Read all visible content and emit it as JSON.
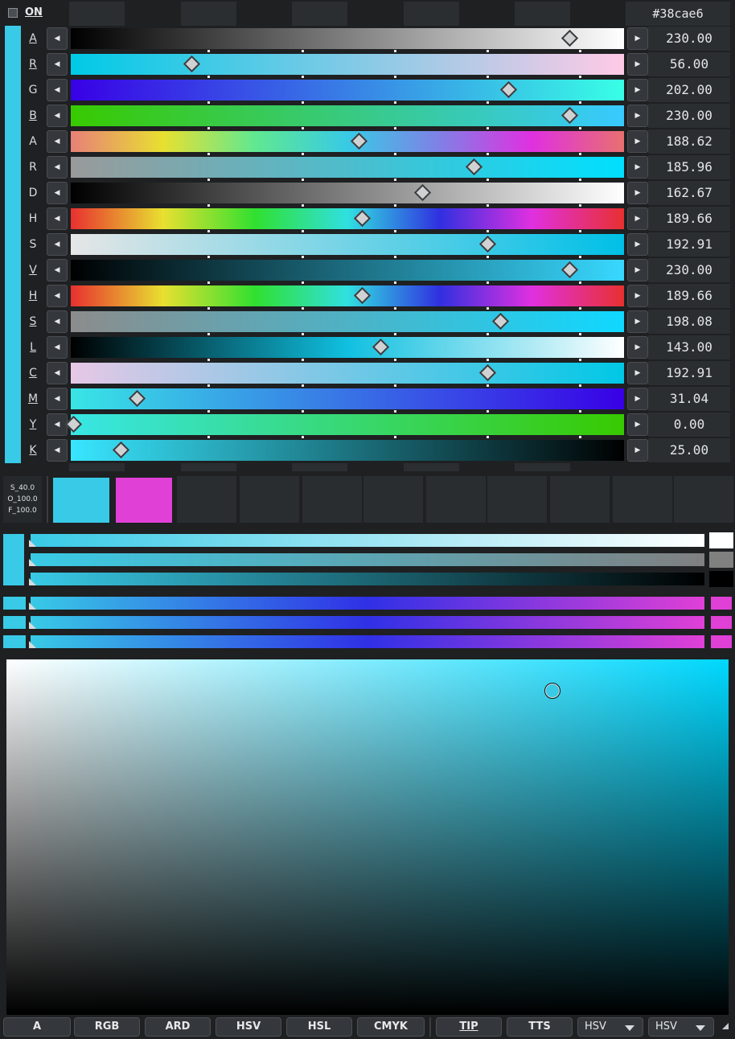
{
  "header": {
    "on_label": "ON",
    "hex": "#38cae6"
  },
  "color": {
    "current": "#38cae6",
    "secondary": "#e040d6"
  },
  "sliders": [
    {
      "label": "A",
      "value": "230.00",
      "fraction": 0.902
    },
    {
      "label": "R",
      "value": "56.00",
      "fraction": 0.22
    },
    {
      "label": "G",
      "value": "202.00",
      "fraction": 0.792
    },
    {
      "label": "B",
      "value": "230.00",
      "fraction": 0.902
    },
    {
      "label": "A",
      "value": "188.62",
      "fraction": 0.522
    },
    {
      "label": "R",
      "value": "185.96",
      "fraction": 0.73
    },
    {
      "label": "D",
      "value": "162.67",
      "fraction": 0.637
    },
    {
      "label": "H",
      "value": "189.66",
      "fraction": 0.527
    },
    {
      "label": "S",
      "value": "192.91",
      "fraction": 0.755
    },
    {
      "label": "V",
      "value": "230.00",
      "fraction": 0.902
    },
    {
      "label": "H",
      "value": "189.66",
      "fraction": 0.527
    },
    {
      "label": "S",
      "value": "198.08",
      "fraction": 0.777
    },
    {
      "label": "L",
      "value": "143.00",
      "fraction": 0.561
    },
    {
      "label": "C",
      "value": "192.91",
      "fraction": 0.755
    },
    {
      "label": "M",
      "value": "31.04",
      "fraction": 0.12
    },
    {
      "label": "Y",
      "value": "0.00",
      "fraction": 0.0
    },
    {
      "label": "K",
      "value": "25.00",
      "fraction": 0.092
    }
  ],
  "swatches": {
    "sof_lines": [
      "S_40.0",
      "O_100.0",
      "F_100.0"
    ],
    "colors": [
      "#38cae6",
      "#e040d6"
    ]
  },
  "tabs": [
    {
      "label": "A"
    },
    {
      "label": "RGB"
    },
    {
      "label": "ARD"
    },
    {
      "label": "HSV"
    },
    {
      "label": "HSL"
    },
    {
      "label": "CMYK"
    },
    {
      "label": "TIP"
    },
    {
      "label": "TTS"
    }
  ],
  "dropdowns": [
    {
      "value": "HSV"
    },
    {
      "value": "HSV"
    }
  ]
}
